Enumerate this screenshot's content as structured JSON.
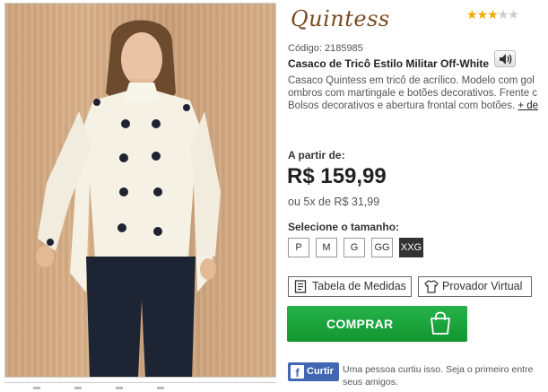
{
  "brand": {
    "logo_text": "Quintess"
  },
  "rating": {
    "value": 3,
    "max": 5
  },
  "product": {
    "code_label": "Código: 2185985",
    "title": "Casaco de Tricô Estilo Militar Off-White",
    "description_lines": [
      "Casaco Quintess em tricô de acrílico. Modelo com gol",
      "ombros com martingale e botões decorativos. Frente c",
      "Bolsos decorativos e abertura frontal com botões."
    ],
    "more_link": "+ de"
  },
  "pricing": {
    "from_label": "A partir de:",
    "price": "R$ 159,99",
    "installments": "ou 5x de R$ 31,99"
  },
  "sizes": {
    "label": "Selecione o tamanho:",
    "options": [
      "P",
      "M",
      "G",
      "GG",
      "XXG"
    ],
    "selected": "XXG"
  },
  "actions": {
    "size_chart": "Tabela de Medidas",
    "virtual_fitting": "Provador Virtual",
    "buy": "COMPRAR"
  },
  "facebook": {
    "like_button": "Curtir",
    "social_text": "Uma pessoa curtiu isso. Seja o primeiro entre seus amigos."
  },
  "colors": {
    "buy_green": "#1aa43c",
    "facebook_blue": "#4267b2",
    "star": "#f2a900",
    "logo": "#7a4a22"
  },
  "icons": [
    "speaker-icon",
    "ruler-icon",
    "shirt-icon",
    "shopping-bag-icon",
    "facebook-icon",
    "star-icon"
  ]
}
